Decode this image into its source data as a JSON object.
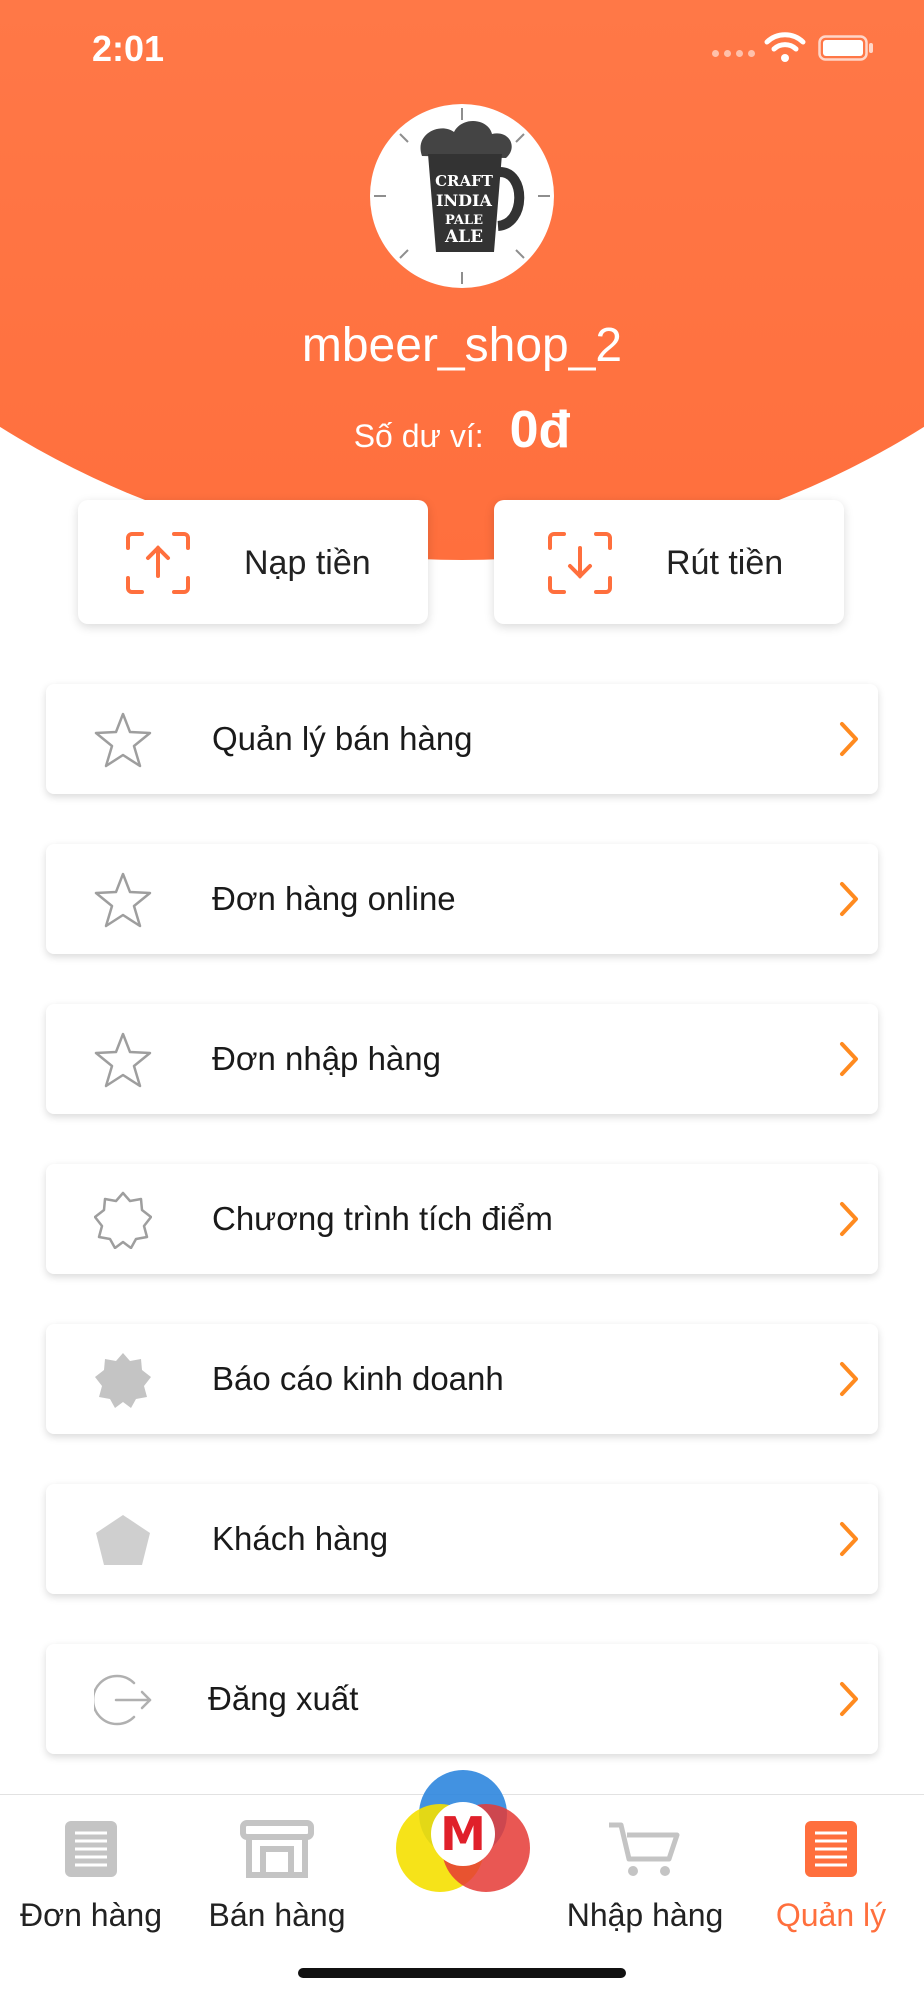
{
  "status_bar": {
    "time": "2:01"
  },
  "profile": {
    "shop_name": "mbeer_shop_2",
    "balance_label": "Số dư ví:",
    "balance_value": "0đ",
    "avatar_text": [
      "CRAFT",
      "INDIA",
      "PALE",
      "ALE"
    ]
  },
  "wallet_actions": [
    {
      "label": "Nạp tiền",
      "icon": "upload-icon"
    },
    {
      "label": "Rút tiền",
      "icon": "download-icon"
    }
  ],
  "menu": [
    {
      "label": "Quản lý bán hàng",
      "icon": "star-outline-icon"
    },
    {
      "label": "Đơn hàng online",
      "icon": "star-outline-icon"
    },
    {
      "label": "Đơn nhập hàng",
      "icon": "star-outline-icon"
    },
    {
      "label": "Chương trình tích điểm",
      "icon": "badge-outline-icon"
    },
    {
      "label": "Báo cáo kinh doanh",
      "icon": "badge-filled-icon"
    },
    {
      "label": "Khách hàng",
      "icon": "pentagon-icon"
    },
    {
      "label": "Đăng xuất",
      "icon": "logout-icon"
    }
  ],
  "tabs": [
    {
      "label": "Đơn hàng",
      "icon": "list-icon",
      "active": false
    },
    {
      "label": "Bán hàng",
      "icon": "store-icon",
      "active": false
    },
    {
      "label": "Nhập hàng",
      "icon": "cart-icon",
      "active": false
    },
    {
      "label": "Quản lý",
      "icon": "list-icon",
      "active": true
    }
  ],
  "center_logo_letter": "M",
  "colors": {
    "accent": "#ff6f3d",
    "chevron": "#ff8a1f",
    "icon_gray": "#bdbdbd"
  }
}
